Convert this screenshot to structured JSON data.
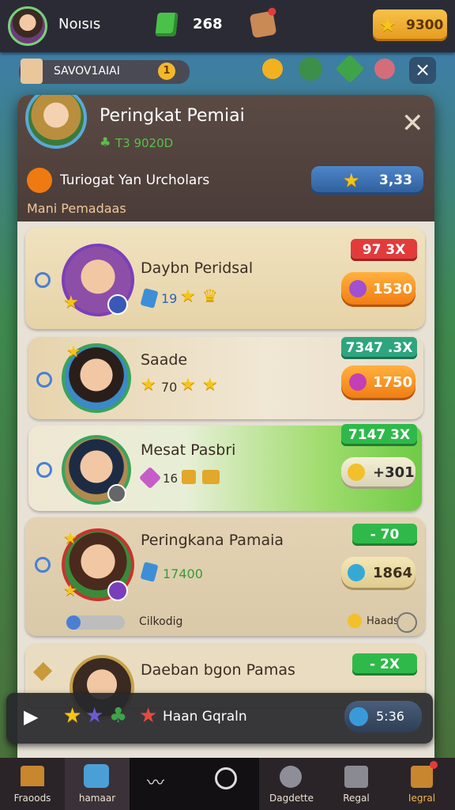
{
  "top_bar": {
    "username": "Noısıs",
    "gem_count": "268",
    "gold_balance": "9300"
  },
  "sub_bar": {
    "label": "SAVOV1AIAI",
    "badge": "1"
  },
  "panel": {
    "title": "Peringkat Pemiai",
    "subtitle": "T3 9020D",
    "section_label": "Turiogat Yan Urcholars",
    "section_value": "3,33",
    "sub_label": "Mani Pemadaas"
  },
  "leaderboard": [
    {
      "name": "Daybn Peridsal",
      "level": "19",
      "tag": "97  3X",
      "score": "1530"
    },
    {
      "name": "Saade",
      "level": "70",
      "tag": "7347 .3X",
      "score": "1750"
    },
    {
      "name": "Mesat Pasbri",
      "level": "16",
      "tag": "7147  3X",
      "score": "+301"
    },
    {
      "name": "Peringkana Pamaia",
      "level": "17400",
      "tag": "- 70",
      "score": "1864",
      "footer_left": "Cilkodig",
      "footer_right": "Haads"
    },
    {
      "name": "Daeban bgon Pamas",
      "tag": "- 2X"
    }
  ],
  "play_bar": {
    "label": "Haan Gqraln",
    "timer": "5:36"
  },
  "nav": {
    "items": [
      {
        "label": "Fraoods"
      },
      {
        "label": "hamaar"
      },
      {
        "label": ""
      },
      {
        "label": ""
      },
      {
        "label": "Dagdette"
      },
      {
        "label": "Regal"
      },
      {
        "label": "Iegral"
      }
    ]
  },
  "colors": {
    "accent_gold": "#f5c518",
    "tag_red": "#e23b3b",
    "tag_green": "#2fb94a",
    "score_orange": "#f07a12"
  }
}
